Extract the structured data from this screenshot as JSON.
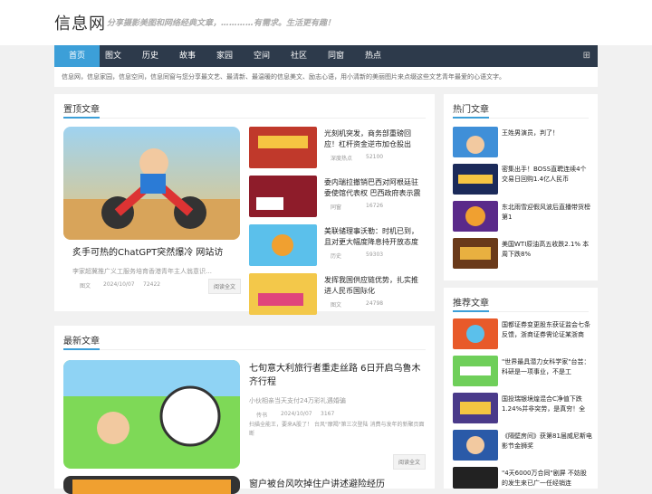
{
  "site": {
    "logo": "信息网",
    "slogan": "分享摄影美图和网络经典文章，…………有需求。生活更有趣！"
  },
  "nav": {
    "items": [
      "首页",
      "图文",
      "历史",
      "故事",
      "家园",
      "空间",
      "社区",
      "同窗",
      "热点"
    ],
    "grid_icon": "grid-icon"
  },
  "intro": "信息网，信息家园，信息空间，信息同窗与您分享最文艺、最清新、最温暖的信息美文、励志心语，用小清新的美丽图片来点缀这些文艺青年最爱的心语文字。",
  "top": {
    "title": "置顶文章",
    "feature": {
      "title": "炙手可热的ChatGPT突然爆冷 网站访",
      "summary": "李家超冀推广义工服务培育香港青年主人翁意识…",
      "cat": "图文",
      "date": "2024/10/07",
      "views": "72422",
      "more": "阅读全文"
    },
    "items": [
      {
        "title": "光刻机突发，商务部重磅回应！杠杆资金逆市加仓股出",
        "cat": "深度热点",
        "views": "52100"
      },
      {
        "title": "委内瑞拉撤销巴西对阿根廷驻委使馆代表权 巴西政府表示震",
        "cat": "同窗",
        "views": "16726"
      },
      {
        "title": "美联储理事沃勒：时机已到，且对更大幅度降息持开放态度",
        "cat": "历史",
        "views": "59303"
      },
      {
        "title": "发挥我国供应链优势，扎实推进人民币国际化",
        "cat": "图文",
        "views": "24798"
      }
    ]
  },
  "latest": {
    "title": "最新文章",
    "items": [
      {
        "title": "七旬意大利旅行者重走丝路 6日开启乌鲁木齐行程",
        "summary": "小伙相亲当天支付24万彩礼遇婚骗",
        "cat": "传书",
        "date": "2024/10/07",
        "views": "3167",
        "tags": "扫描全能王，要来A股了！ 台风\"摩羯\"第三次登陆 消费与发年的新聚页面断",
        "more": "阅读全文"
      },
      {
        "title": "窗户被台风吹掉住户讲述避险经历"
      }
    ]
  },
  "hot": {
    "title": "热门文章",
    "items": [
      "王姓男演员，判了！",
      "密集出手！BOSS直聘连续4个交易日回购1.4亿人民币",
      "东北雨雪迎假风波后直播带货榜第1",
      "美国WTI原油高五收跌2.1% 本周下跌8%"
    ]
  },
  "rec": {
    "title": "推荐文章",
    "items": [
      "国都证券变更股东获证监会七条反馈，浙商证券需论证某浙商",
      "\"世界最具潜力女科学家\"台芸：科研是一项事业，不是工",
      "国投瑞银境煌混合C净值下跌1.24%并非突劳，是真穷！全",
      "《隔壁房间》获第81届威尼斯电影节金狮奖",
      "\"4天6000万合同\"剧屏 不妨股的发生来已广一任经销连"
    ]
  }
}
